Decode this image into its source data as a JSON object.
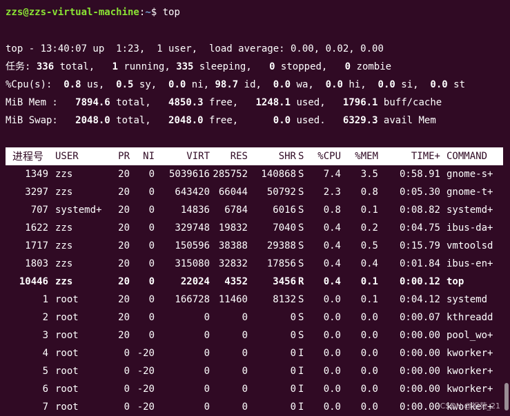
{
  "prompt": {
    "user_host": "zzs@zzs-virtual-machine",
    "sep": ":",
    "path": "~",
    "symbol": "$ ",
    "command": "top"
  },
  "summary": {
    "uptime_line": "top - 13:40:07 up  1:23,  1 user,  load average: 0.00, 0.02, 0.00",
    "tasks": {
      "label": "任务: ",
      "total": "336",
      "total_lbl": " total,   ",
      "running": "1",
      "running_lbl": " running, ",
      "sleeping": "335",
      "sleeping_lbl": " sleeping,   ",
      "stopped": "0",
      "stopped_lbl": " stopped,   ",
      "zombie": "0",
      "zombie_lbl": " zombie"
    },
    "cpu": {
      "label": "%Cpu(s):  ",
      "us": "0.8",
      "us_lbl": " us,  ",
      "sy": "0.5",
      "sy_lbl": " sy,  ",
      "ni": "0.0",
      "ni_lbl": " ni, ",
      "id": "98.7",
      "id_lbl": " id,  ",
      "wa": "0.0",
      "wa_lbl": " wa,  ",
      "hi": "0.0",
      "hi_lbl": " hi,  ",
      "si": "0.0",
      "si_lbl": " si,  ",
      "st": "0.0",
      "st_lbl": " st"
    },
    "mem": {
      "label": "MiB Mem :   ",
      "total": "7894.6",
      "total_lbl": " total,   ",
      "free": "4850.3",
      "free_lbl": " free,   ",
      "used": "1248.1",
      "used_lbl": " used,   ",
      "buff": "1796.1",
      "buff_lbl": " buff/cache"
    },
    "swap": {
      "label": "MiB Swap:   ",
      "total": "2048.0",
      "total_lbl": " total,   ",
      "free": "2048.0",
      "free_lbl": " free,      ",
      "used": "0.0",
      "used_lbl": " used.   ",
      "avail": "6329.3",
      "avail_lbl": " avail Mem"
    }
  },
  "table": {
    "headers": [
      "进程号",
      "USER",
      "PR",
      "NI",
      "VIRT",
      "RES",
      "SHR",
      "S",
      "%CPU",
      "%MEM",
      "TIME+",
      "COMMAND"
    ],
    "rows": [
      [
        "1349",
        "zzs",
        "20",
        "0",
        "5039616",
        "285752",
        "140868",
        "S",
        "7.4",
        "3.5",
        "0:58.91",
        "gnome-s+"
      ],
      [
        "3297",
        "zzs",
        "20",
        "0",
        "643420",
        "66044",
        "50792",
        "S",
        "2.3",
        "0.8",
        "0:05.30",
        "gnome-t+"
      ],
      [
        "707",
        "systemd+",
        "20",
        "0",
        "14836",
        "6784",
        "6016",
        "S",
        "0.8",
        "0.1",
        "0:08.82",
        "systemd+"
      ],
      [
        "1622",
        "zzs",
        "20",
        "0",
        "329748",
        "19832",
        "7040",
        "S",
        "0.4",
        "0.2",
        "0:04.75",
        "ibus-da+"
      ],
      [
        "1717",
        "zzs",
        "20",
        "0",
        "150596",
        "38388",
        "29388",
        "S",
        "0.4",
        "0.5",
        "0:15.79",
        "vmtoolsd"
      ],
      [
        "1803",
        "zzs",
        "20",
        "0",
        "315080",
        "32832",
        "17856",
        "S",
        "0.4",
        "0.4",
        "0:01.84",
        "ibus-en+"
      ],
      [
        "10446",
        "zzs",
        "20",
        "0",
        "22024",
        "4352",
        "3456",
        "R",
        "0.4",
        "0.1",
        "0:00.12",
        "top"
      ],
      [
        "1",
        "root",
        "20",
        "0",
        "166728",
        "11460",
        "8132",
        "S",
        "0.0",
        "0.1",
        "0:04.12",
        "systemd"
      ],
      [
        "2",
        "root",
        "20",
        "0",
        "0",
        "0",
        "0",
        "S",
        "0.0",
        "0.0",
        "0:00.07",
        "kthreadd"
      ],
      [
        "3",
        "root",
        "20",
        "0",
        "0",
        "0",
        "0",
        "S",
        "0.0",
        "0.0",
        "0:00.00",
        "pool_wo+"
      ],
      [
        "4",
        "root",
        "0",
        "-20",
        "0",
        "0",
        "0",
        "I",
        "0.0",
        "0.0",
        "0:00.00",
        "kworker+"
      ],
      [
        "5",
        "root",
        "0",
        "-20",
        "0",
        "0",
        "0",
        "I",
        "0.0",
        "0.0",
        "0:00.00",
        "kworker+"
      ],
      [
        "6",
        "root",
        "0",
        "-20",
        "0",
        "0",
        "0",
        "I",
        "0.0",
        "0.0",
        "0:00.00",
        "kworker+"
      ],
      [
        "7",
        "root",
        "0",
        "-20",
        "0",
        "0",
        "0",
        "I",
        "0.0",
        "0.0",
        "0:00.00",
        "kworker+"
      ]
    ],
    "highlight_row": 6
  },
  "watermark": "CSDN @祀苑_21",
  "colors": {
    "background": "#300a24",
    "prompt_user": "#8ae234",
    "prompt_path": "#729fcf",
    "header_bg": "#ffffff"
  }
}
